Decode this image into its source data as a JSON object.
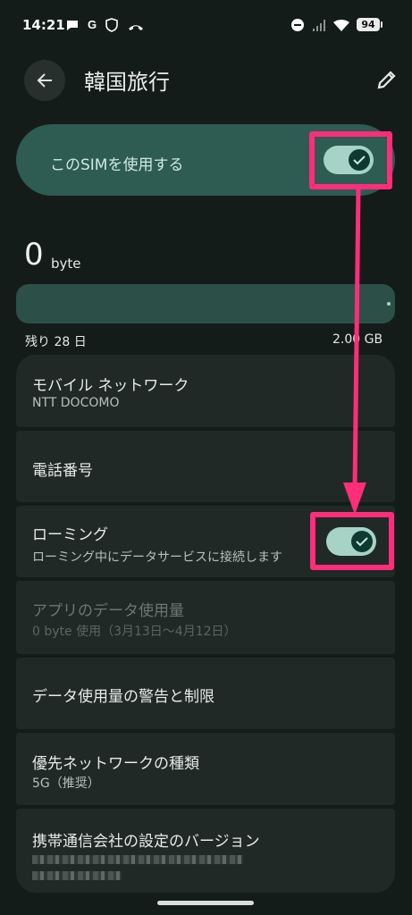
{
  "status_bar": {
    "time": "14:21",
    "battery": "94"
  },
  "header": {
    "title": "韓国旅行"
  },
  "sim": {
    "label": "このSIMを使用する",
    "enabled": true
  },
  "usage": {
    "amount": "0",
    "unit": "byte",
    "remaining": "残り 28 日",
    "total": "2.00 GB"
  },
  "list": {
    "mobile_network": {
      "label": "モバイル ネットワーク",
      "sub": "NTT DOCOMO"
    },
    "phone_number": {
      "label": "電話番号"
    },
    "roaming": {
      "label": "ローミング",
      "sub": "ローミング中にデータサービスに接続します",
      "enabled": true
    },
    "app_data": {
      "label": "アプリのデータ使用量",
      "sub": "0 byte 使用（3月13日〜4月12日）"
    },
    "data_warning": {
      "label": "データ使用量の警告と制限"
    },
    "preferred_network": {
      "label": "優先ネットワークの種類",
      "sub": "5G（推奨）"
    },
    "carrier_config": {
      "label": "携帯通信会社の設定のバージョン"
    }
  },
  "colors": {
    "accent": "#ff2d7a",
    "toggle_on": "#a7d3c6",
    "sim_card": "#2e5b52"
  }
}
